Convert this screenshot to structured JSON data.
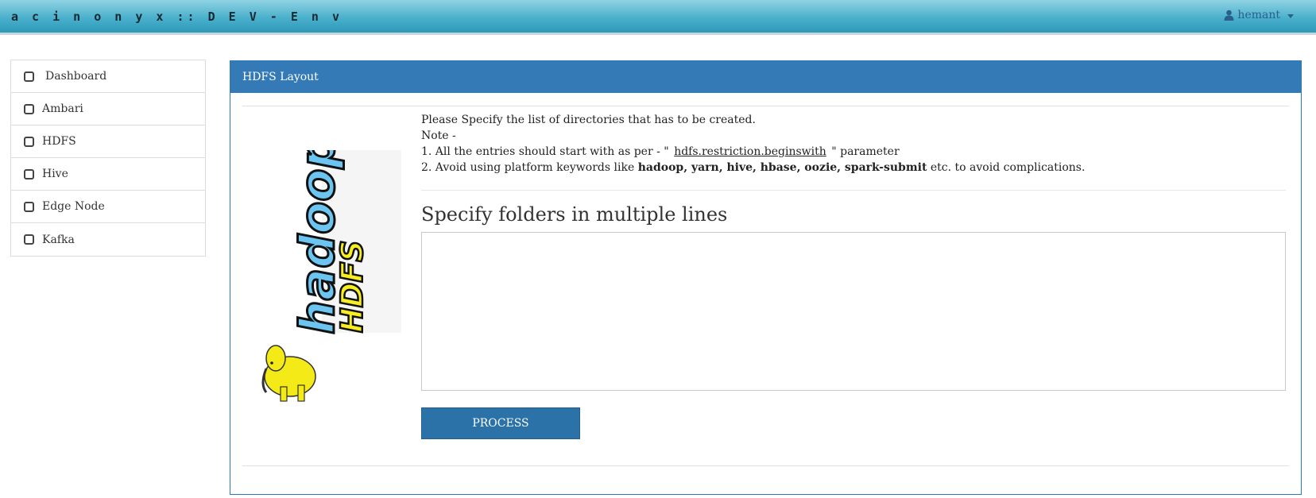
{
  "header": {
    "brand": "a c i n o n y x  ::  D E V - E n v",
    "user_name": "hemant",
    "user_icon": "user-icon"
  },
  "sidebar": {
    "items": [
      {
        "label": "Dashboard"
      },
      {
        "label": "Ambari"
      },
      {
        "label": "HDFS"
      },
      {
        "label": "Hive"
      },
      {
        "label": "Edge Node"
      },
      {
        "label": "Kafka"
      }
    ]
  },
  "panel": {
    "title": "HDFS Layout",
    "logo_text_top": "hadoop",
    "logo_text_sub": "HDFS",
    "instructions": {
      "line1": "Please Specify the list of directories that has to be created.",
      "note": "Note -",
      "entry1_prefix": "1. All the entries should start with as per - \"",
      "entry1_param": "hdfs.restriction.beginswith",
      "entry1_suffix": "\" parameter",
      "entry2_prefix": "2. Avoid using platform keywords like ",
      "entry2_keywords": "hadoop, yarn, hive, hbase, oozie, spark-submit",
      "entry2_suffix": " etc. to avoid complications."
    },
    "heading": "Specify folders in multiple lines",
    "textarea_value": "",
    "process_button": "PROCESS"
  },
  "colors": {
    "accent": "#337ab7",
    "button": "#2a72a8",
    "topbar": "#4ab0cc"
  }
}
